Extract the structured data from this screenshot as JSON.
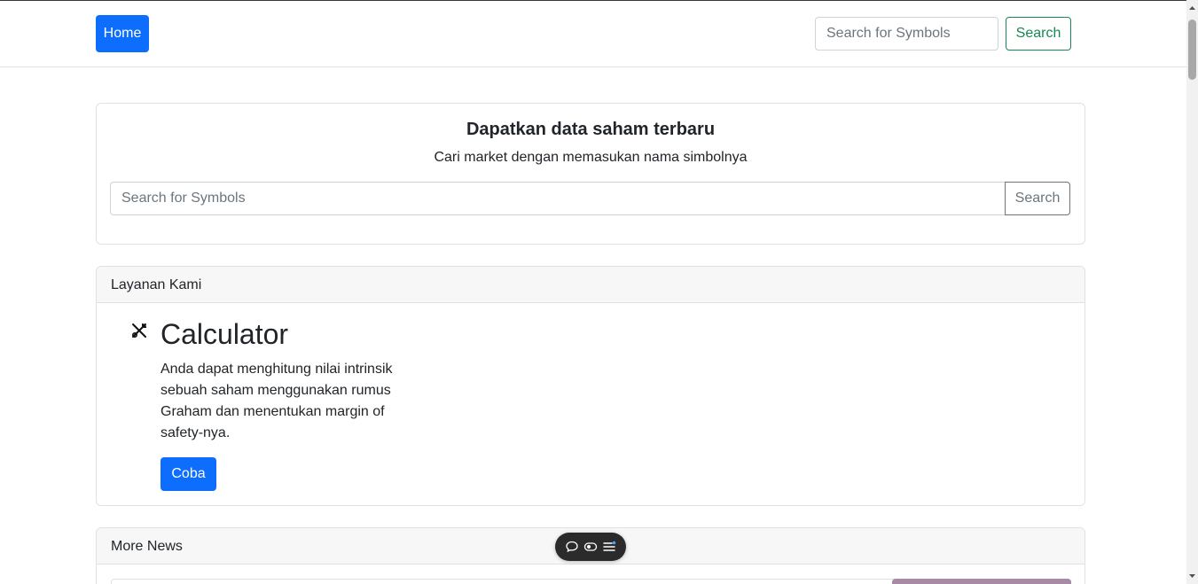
{
  "navbar": {
    "home_label": "Home",
    "search_placeholder": "Search for Symbols",
    "search_button": "Search"
  },
  "hero": {
    "title": "Dapatkan data saham terbaru",
    "subtitle": "Cari market dengan memasukan nama simbolnya",
    "search_placeholder": "Search for Symbols",
    "search_button": "Search"
  },
  "services": {
    "header": "Layanan Kami",
    "icon": "tools-icon",
    "calculator": {
      "title": "Calculator",
      "description": "Anda dapat menghitung nilai intrinsik sebuah saham menggunakan rumus Graham dan menentukan margin of safety-nya.",
      "button": "Coba"
    }
  },
  "news": {
    "header": "More News"
  },
  "floating_toolbar": {
    "icons": [
      "chat-bubble-icon",
      "toggle-icon",
      "menu-list-icon"
    ]
  },
  "colors": {
    "primary": "#0d6efd",
    "success": "#198754",
    "secondary": "#6c757d",
    "card_header_bg": "#f7f7f7",
    "news_thumb": "#a88aa6"
  }
}
